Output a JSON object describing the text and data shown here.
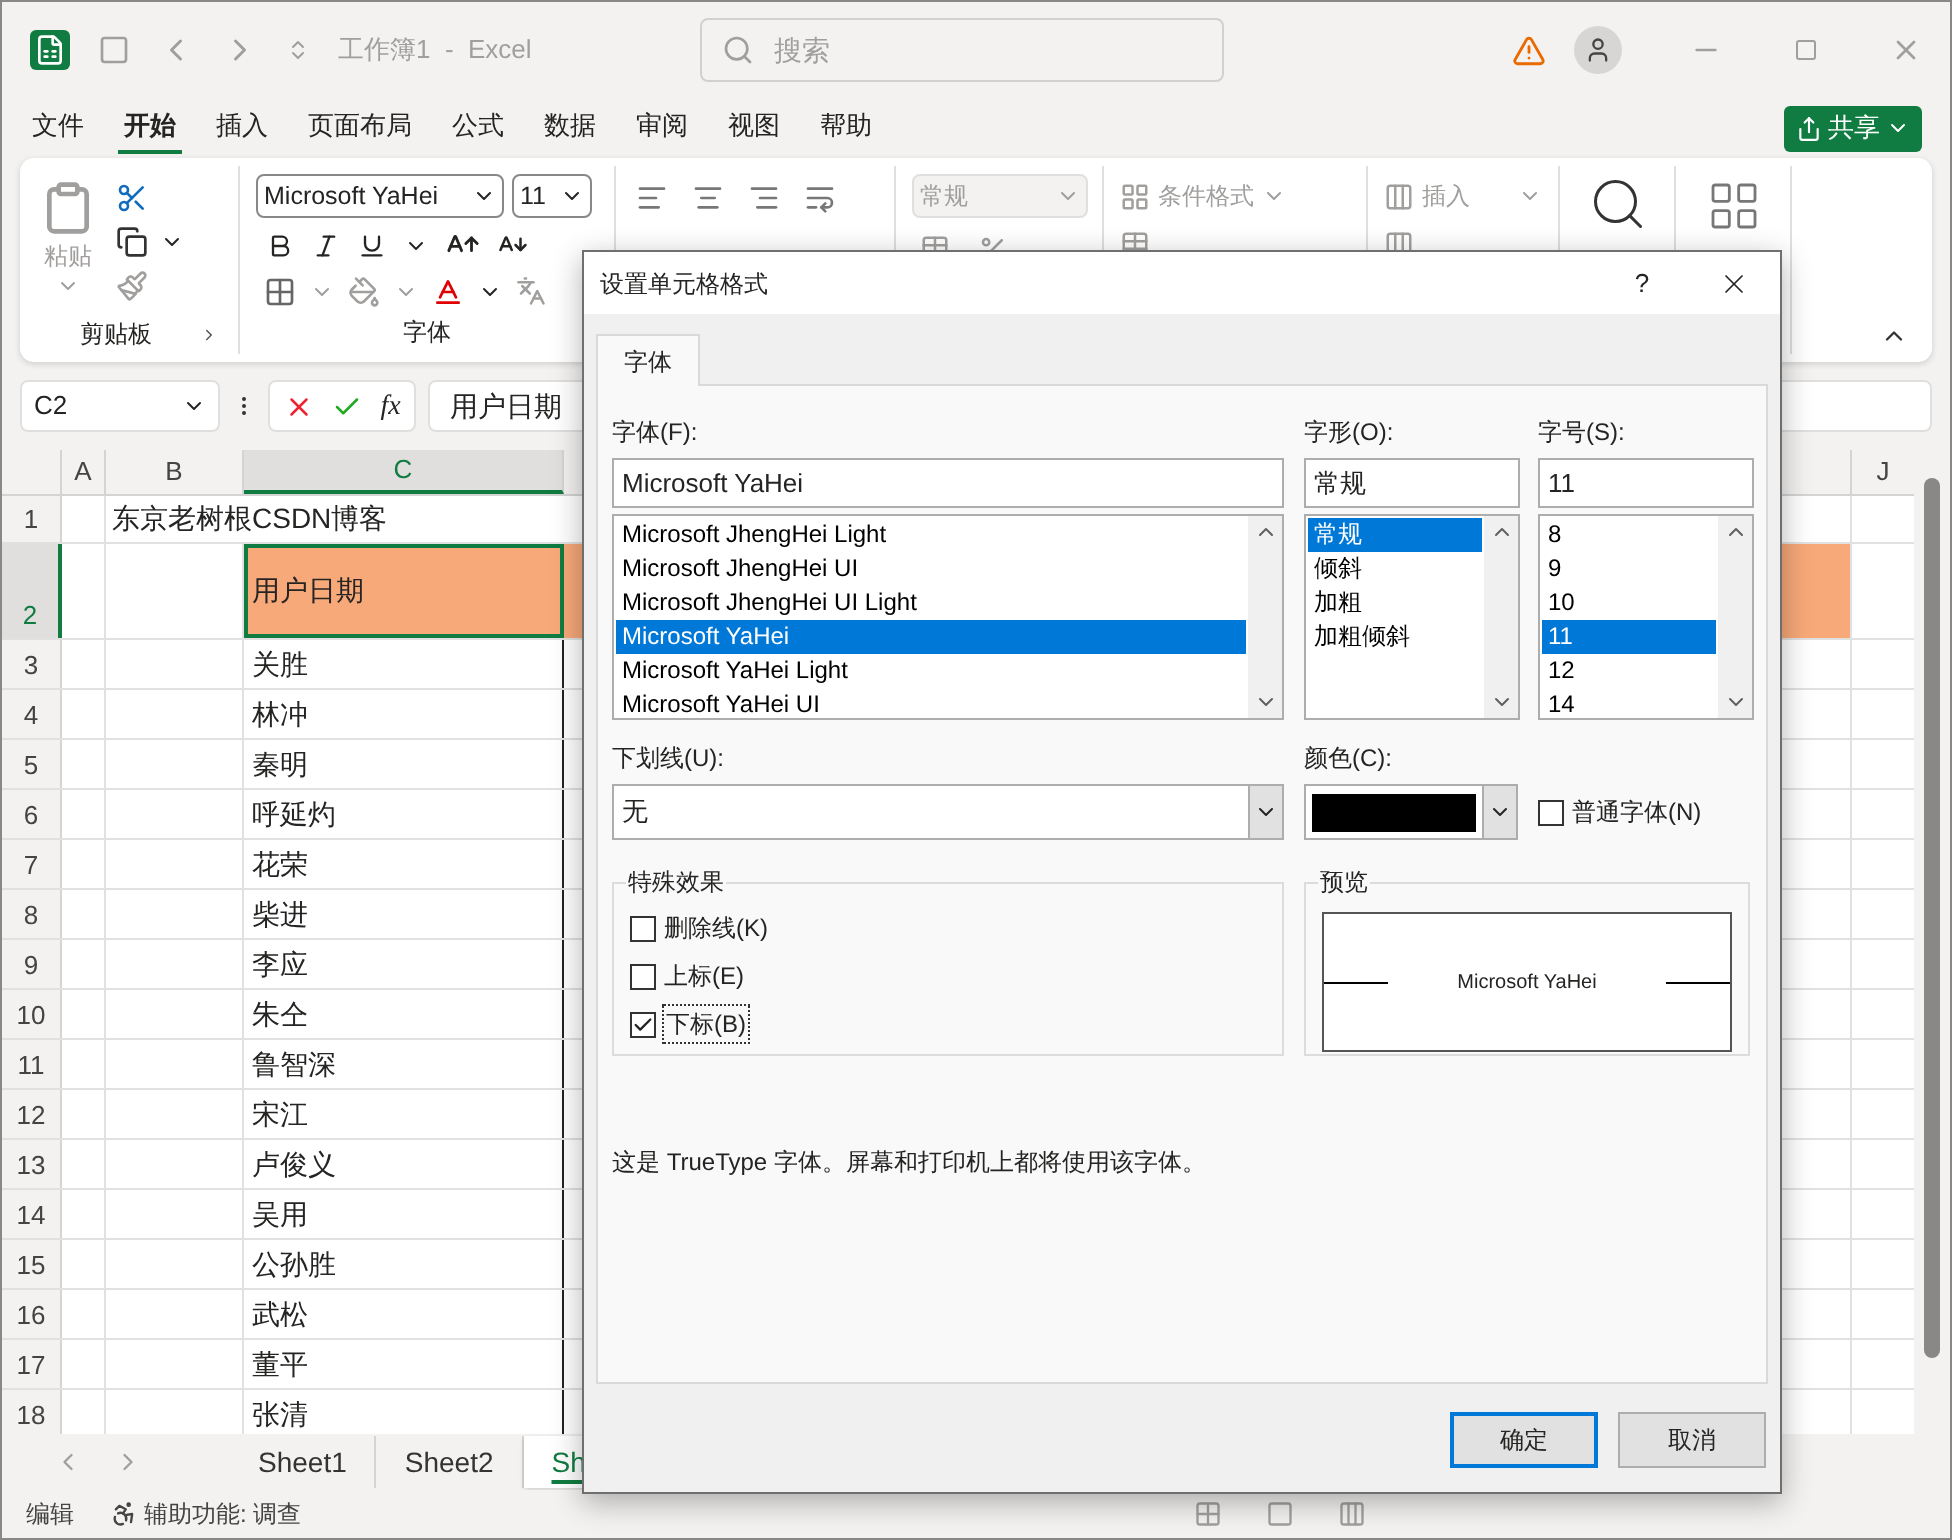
{
  "title_bar": {
    "title": "工作簿1  -  Excel",
    "search_placeholder": "搜索"
  },
  "menu_tabs": [
    {
      "label": "文件",
      "selected": false
    },
    {
      "label": "开始",
      "selected": true
    },
    {
      "label": "插入",
      "selected": false
    },
    {
      "label": "页面布局",
      "selected": false
    },
    {
      "label": "公式",
      "selected": false
    },
    {
      "label": "数据",
      "selected": false
    },
    {
      "label": "审阅",
      "selected": false
    },
    {
      "label": "视图",
      "selected": false
    },
    {
      "label": "帮助",
      "selected": false
    }
  ],
  "share_button": "共享",
  "ribbon": {
    "paste": "粘贴",
    "clipboard_group": "剪贴板",
    "font_group": "字体",
    "font_name": "Microsoft YaHei",
    "font_size": "11",
    "number_format": "常规",
    "conditional_format": "条件格式",
    "insert": "插入"
  },
  "formula_bar": {
    "name_box": "C2",
    "function_symbol": "fx",
    "content": "用户日期"
  },
  "columns": [
    {
      "label": "A",
      "selected": false
    },
    {
      "label": "B",
      "selected": false
    },
    {
      "label": "C",
      "selected": true
    },
    {
      "label": "J",
      "selected": false
    }
  ],
  "rows": [
    {
      "number": "1",
      "selected": false,
      "kind": "title",
      "value": "东京老树根CSDN博客"
    },
    {
      "number": "2",
      "selected": true,
      "kind": "header",
      "value": "用户日期"
    },
    {
      "number": "3",
      "selected": false,
      "kind": "name",
      "value": "关胜"
    },
    {
      "number": "4",
      "selected": false,
      "kind": "name",
      "value": "林冲"
    },
    {
      "number": "5",
      "selected": false,
      "kind": "name",
      "value": "秦明"
    },
    {
      "number": "6",
      "selected": false,
      "kind": "name",
      "value": "呼延灼"
    },
    {
      "number": "7",
      "selected": false,
      "kind": "name",
      "value": "花荣"
    },
    {
      "number": "8",
      "selected": false,
      "kind": "name",
      "value": "柴进"
    },
    {
      "number": "9",
      "selected": false,
      "kind": "name",
      "value": "李应"
    },
    {
      "number": "10",
      "selected": false,
      "kind": "name",
      "value": "朱仝"
    },
    {
      "number": "11",
      "selected": false,
      "kind": "name",
      "value": "鲁智深"
    },
    {
      "number": "12",
      "selected": false,
      "kind": "name",
      "value": "宋江"
    },
    {
      "number": "13",
      "selected": false,
      "kind": "name",
      "value": "卢俊义"
    },
    {
      "number": "14",
      "selected": false,
      "kind": "name",
      "value": "吴用"
    },
    {
      "number": "15",
      "selected": false,
      "kind": "name",
      "value": "公孙胜"
    },
    {
      "number": "16",
      "selected": false,
      "kind": "name",
      "value": "武松"
    },
    {
      "number": "17",
      "selected": false,
      "kind": "name",
      "value": "董平"
    },
    {
      "number": "18",
      "selected": false,
      "kind": "name",
      "value": "张清"
    }
  ],
  "sheet_tabs": [
    {
      "label": "Sheet1",
      "selected": false
    },
    {
      "label": "Sheet2",
      "selected": false
    },
    {
      "label": "Sh",
      "selected": true
    }
  ],
  "status_bar": {
    "mode": "编辑",
    "accessibility": "辅助功能: 调查"
  },
  "dialog": {
    "title": "设置单元格格式",
    "help": "?",
    "tabs": [
      {
        "label": "字体",
        "selected": true
      }
    ],
    "font": {
      "label": "字体(F):",
      "value": "Microsoft YaHei",
      "options": [
        {
          "label": "Microsoft JhengHei Light",
          "selected": false
        },
        {
          "label": "Microsoft JhengHei UI",
          "selected": false
        },
        {
          "label": "Microsoft JhengHei UI Light",
          "selected": false
        },
        {
          "label": "Microsoft YaHei",
          "selected": true
        },
        {
          "label": "Microsoft YaHei Light",
          "selected": false
        },
        {
          "label": "Microsoft YaHei UI",
          "selected": false
        }
      ]
    },
    "style": {
      "label": "字形(O):",
      "value": "常规",
      "options": [
        {
          "label": "常规",
          "selected": true
        },
        {
          "label": "倾斜",
          "selected": false
        },
        {
          "label": "加粗",
          "selected": false
        },
        {
          "label": "加粗倾斜",
          "selected": false
        }
      ]
    },
    "size": {
      "label": "字号(S):",
      "value": "11",
      "options": [
        {
          "label": "8",
          "selected": false
        },
        {
          "label": "9",
          "selected": false
        },
        {
          "label": "10",
          "selected": false
        },
        {
          "label": "11",
          "selected": true
        },
        {
          "label": "12",
          "selected": false
        },
        {
          "label": "14",
          "selected": false
        }
      ]
    },
    "underline": {
      "label": "下划线(U):",
      "value": "无"
    },
    "color": {
      "label": "颜色(C):",
      "color": "#000000"
    },
    "normal_font": {
      "label": "普通字体(N)",
      "checked": false
    },
    "effects": {
      "title": "特殊效果",
      "options": [
        {
          "label": "删除线(K)",
          "checked": false
        },
        {
          "label": "上标(E)",
          "checked": false
        },
        {
          "label": "下标(B)",
          "checked": true
        }
      ]
    },
    "preview": {
      "title": "预览",
      "sample": "Microsoft YaHei"
    },
    "info": "这是 TrueType 字体。屏幕和打印机上都将使用该字体。",
    "buttons": [
      {
        "label": "确定",
        "default": true
      },
      {
        "label": "取消",
        "default": false
      }
    ]
  }
}
